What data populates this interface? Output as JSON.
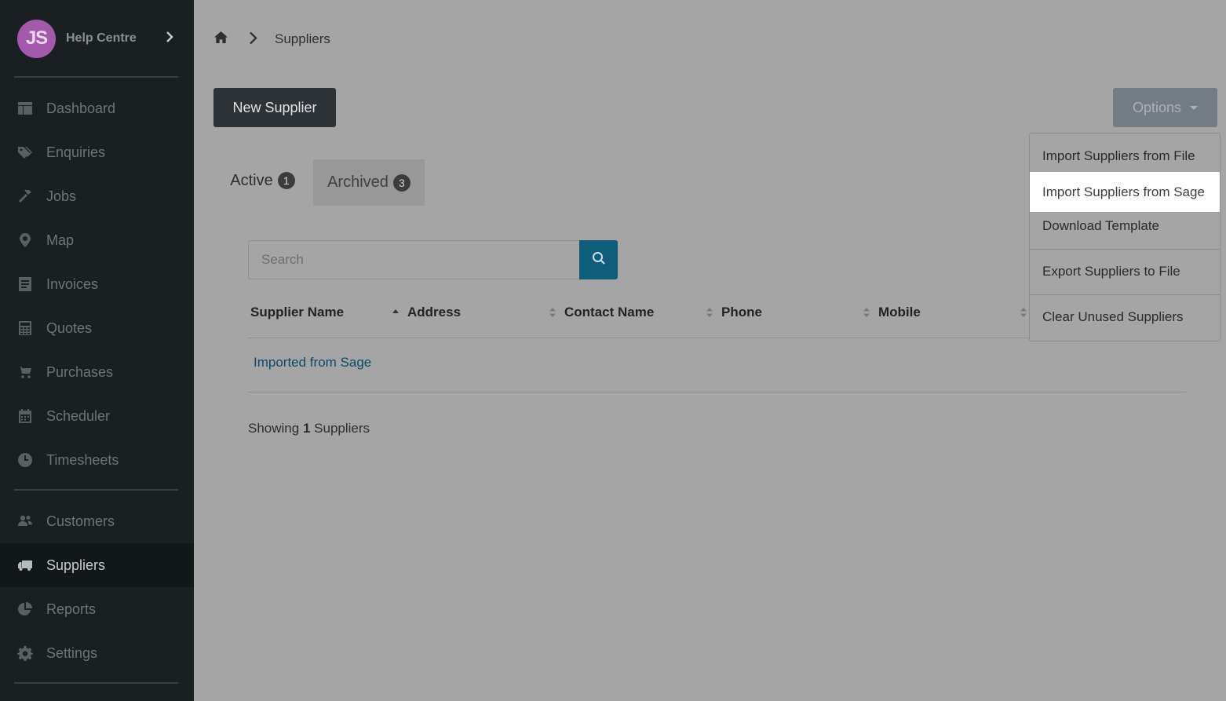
{
  "profile": {
    "initials": "JS",
    "title": "Help Centre"
  },
  "sidebar": {
    "items": [
      {
        "label": "Dashboard",
        "icon": "dashboard-icon"
      },
      {
        "label": "Enquiries",
        "icon": "tags-icon"
      },
      {
        "label": "Jobs",
        "icon": "hammer-icon"
      },
      {
        "label": "Map",
        "icon": "map-pin-icon"
      },
      {
        "label": "Invoices",
        "icon": "invoice-icon"
      },
      {
        "label": "Quotes",
        "icon": "calculator-icon"
      },
      {
        "label": "Purchases",
        "icon": "cart-icon"
      },
      {
        "label": "Scheduler",
        "icon": "calendar-icon"
      },
      {
        "label": "Timesheets",
        "icon": "clock-icon"
      },
      {
        "label": "Customers",
        "icon": "users-icon"
      },
      {
        "label": "Suppliers",
        "icon": "truck-icon"
      },
      {
        "label": "Reports",
        "icon": "pie-chart-icon"
      },
      {
        "label": "Settings",
        "icon": "gear-icon"
      }
    ],
    "active": "Suppliers"
  },
  "breadcrumb": {
    "current": "Suppliers"
  },
  "toolbar": {
    "new_label": "New Supplier",
    "options_label": "Options"
  },
  "tabs": [
    {
      "label": "Active",
      "count": "1"
    },
    {
      "label": "Archived",
      "count": "3"
    }
  ],
  "search": {
    "placeholder": "Search"
  },
  "table": {
    "columns": [
      "Supplier Name",
      "Address",
      "Contact Name",
      "Phone",
      "Mobile"
    ],
    "rows": [
      {
        "name": "Imported from Sage"
      }
    ]
  },
  "footer": {
    "prefix": "Showing",
    "count": "1",
    "suffix": "Suppliers"
  },
  "options_menu": {
    "items": [
      "Import Suppliers from File",
      "Import Suppliers from Sage",
      "Download Template",
      "Export Suppliers to File",
      "Clear Unused Suppliers"
    ],
    "highlighted": "Import Suppliers from Sage"
  },
  "colors": {
    "sidebar": "#1a1f22",
    "accent": "#0d5d7b",
    "link": "#0c4b68",
    "avatar": "#a35aaa"
  }
}
